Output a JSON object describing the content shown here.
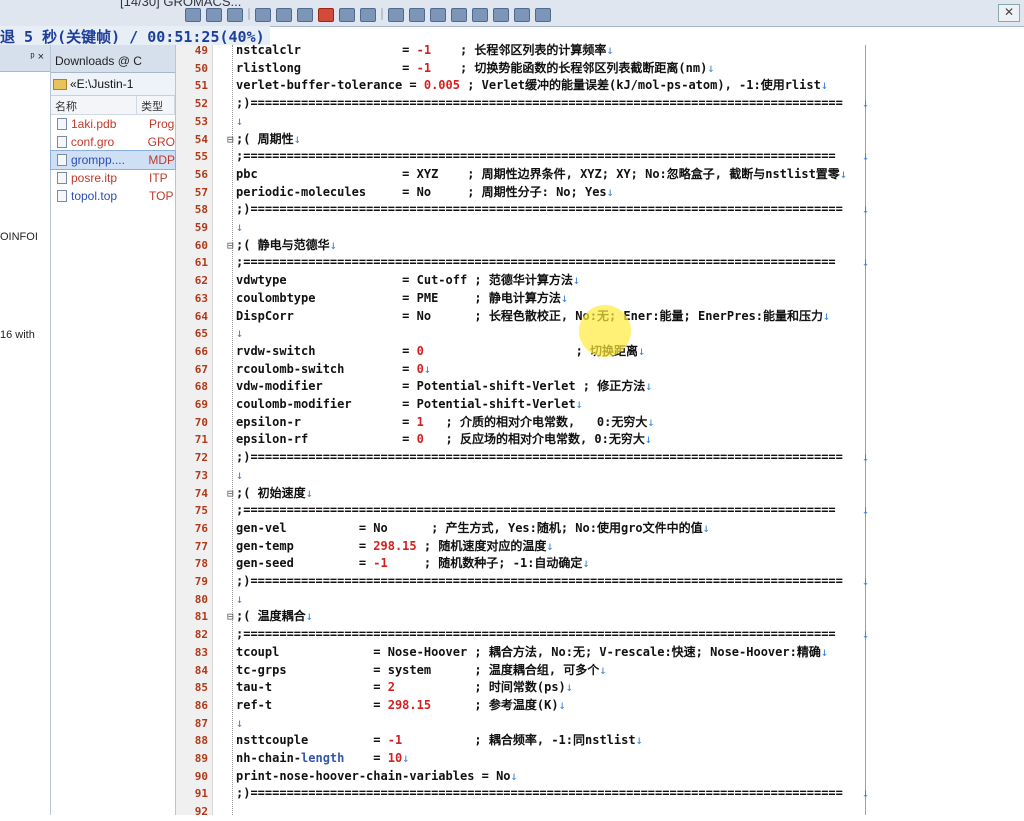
{
  "window": {
    "title": "[14/30] GROMACS...",
    "close_label": "✕"
  },
  "recording": {
    "text": "退 5 秒(关键帧) / 00:51:25(40%)"
  },
  "left_panel": {
    "pin": "ᵖ ×",
    "texts": [
      "OINFOI",
      "16 with"
    ]
  },
  "file_panel": {
    "tab_label": "Downloads @ C",
    "path_label": "«E:\\Justin-1",
    "columns": [
      "名称",
      "类型"
    ],
    "files": [
      {
        "name": "1aki.pdb",
        "type": "Prog",
        "color": "red"
      },
      {
        "name": "conf.gro",
        "type": "GRO",
        "color": "red"
      },
      {
        "name": "grompp....",
        "type": "MDP",
        "color": "blue",
        "selected": true
      },
      {
        "name": "posre.itp",
        "type": "ITP",
        "color": "red"
      },
      {
        "name": "topol.top",
        "type": "TOP",
        "color": "blue"
      }
    ]
  },
  "editor": {
    "lines": [
      {
        "n": "49",
        "fold": "",
        "segs": [
          {
            "t": "nstcalclr              = "
          },
          {
            "t": "-1",
            "c": "val"
          },
          {
            "t": "    ; 长程邻区列表的计算频率"
          }
        ],
        "eol": "↓"
      },
      {
        "n": "50",
        "fold": "",
        "segs": [
          {
            "t": "rlistlong              = "
          },
          {
            "t": "-1",
            "c": "val"
          },
          {
            "t": "    ; 切换势能函数的长程邻区列表截断距离(nm)"
          }
        ],
        "eol": "↓"
      },
      {
        "n": "51",
        "fold": "",
        "segs": [
          {
            "t": "verlet-buffer-tolerance = "
          },
          {
            "t": "0.005",
            "c": "val"
          },
          {
            "t": " ; Verlet缓冲的能量误差(kJ/mol-ps-atom), -1:使用rlist"
          }
        ],
        "eol": "↓"
      },
      {
        "n": "52",
        "fold": "",
        "segs": [
          {
            "t": ";)=================================================================================="
          }
        ],
        "eol": "",
        "eolm": "↓"
      },
      {
        "n": "53",
        "fold": "",
        "segs": [],
        "eol": "↓"
      },
      {
        "n": "54",
        "fold": "⊟",
        "segs": [
          {
            "t": ";( 周期性"
          }
        ],
        "eol": "↓"
      },
      {
        "n": "55",
        "fold": "",
        "segs": [
          {
            "t": ";=================================================================================="
          }
        ],
        "eol": "",
        "eolm": "↓"
      },
      {
        "n": "56",
        "fold": "",
        "segs": [
          {
            "t": "pbc                    = XYZ    ; 周期性边界条件, XYZ; XY; No:忽略盒子, 截断与nstlist置零"
          }
        ],
        "eol": "↓"
      },
      {
        "n": "57",
        "fold": "",
        "segs": [
          {
            "t": "periodic-molecules     = No     ; 周期性分子: No; Yes"
          }
        ],
        "eol": "↓"
      },
      {
        "n": "58",
        "fold": "",
        "segs": [
          {
            "t": ";)=================================================================================="
          }
        ],
        "eol": "",
        "eolm": "↓"
      },
      {
        "n": "59",
        "fold": "",
        "segs": [],
        "eol": "↓"
      },
      {
        "n": "60",
        "fold": "⊟",
        "segs": [
          {
            "t": ";( 静电与范德华"
          }
        ],
        "eol": "↓"
      },
      {
        "n": "61",
        "fold": "",
        "segs": [
          {
            "t": ";=================================================================================="
          }
        ],
        "eol": "",
        "eolm": "↓"
      },
      {
        "n": "62",
        "fold": "",
        "segs": [
          {
            "t": "vdwtype                = Cut-off ; 范德华计算方法"
          }
        ],
        "eol": "↓"
      },
      {
        "n": "63",
        "fold": "",
        "segs": [
          {
            "t": "coulombtype            = PME     ; 静电计算方法"
          }
        ],
        "eol": "↓"
      },
      {
        "n": "64",
        "fold": "",
        "segs": [
          {
            "t": "DispCorr               = No      ; 长程色散校正, No:无; Ener:能量; EnerPres:能量和压力"
          }
        ],
        "eol": "↓"
      },
      {
        "n": "65",
        "fold": "",
        "segs": [],
        "eol": "↓"
      },
      {
        "n": "66",
        "fold": "",
        "segs": [
          {
            "t": "rvdw-switch            = "
          },
          {
            "t": "0",
            "c": "val"
          },
          {
            "t": "                     ; 切换距离"
          }
        ],
        "eol": "↓"
      },
      {
        "n": "67",
        "fold": "",
        "segs": [
          {
            "t": "rcoulomb-switch        = "
          },
          {
            "t": "0",
            "c": "val"
          }
        ],
        "eol": "↓"
      },
      {
        "n": "68",
        "fold": "",
        "segs": [
          {
            "t": "vdw-modifier           = Potential-shift-Verlet ; 修正方法"
          }
        ],
        "eol": "↓"
      },
      {
        "n": "69",
        "fold": "",
        "segs": [
          {
            "t": "coulomb-modifier       = Potential-shift-Verlet"
          }
        ],
        "eol": "↓"
      },
      {
        "n": "70",
        "fold": "",
        "segs": [
          {
            "t": "epsilon-r              = "
          },
          {
            "t": "1",
            "c": "val"
          },
          {
            "t": "   ; 介质的相对介电常数,   0:无穷大"
          }
        ],
        "eol": "↓"
      },
      {
        "n": "71",
        "fold": "",
        "segs": [
          {
            "t": "epsilon-rf             = "
          },
          {
            "t": "0",
            "c": "val"
          },
          {
            "t": "   ; 反应场的相对介电常数, 0:无穷大"
          }
        ],
        "eol": "↓"
      },
      {
        "n": "72",
        "fold": "",
        "segs": [
          {
            "t": ";)=================================================================================="
          }
        ],
        "eol": "",
        "eolm": "↓"
      },
      {
        "n": "73",
        "fold": "",
        "segs": [],
        "eol": "↓"
      },
      {
        "n": "74",
        "fold": "⊟",
        "segs": [
          {
            "t": ";( 初始速度"
          }
        ],
        "eol": "↓"
      },
      {
        "n": "75",
        "fold": "",
        "segs": [
          {
            "t": ";=================================================================================="
          }
        ],
        "eol": "",
        "eolm": "↓"
      },
      {
        "n": "76",
        "fold": "",
        "segs": [
          {
            "t": "gen-vel          = No      ; 产生方式, Yes:随机; No:使用gro文件中的值"
          }
        ],
        "eol": "↓"
      },
      {
        "n": "77",
        "fold": "",
        "segs": [
          {
            "t": "gen-temp         = "
          },
          {
            "t": "298.15",
            "c": "val"
          },
          {
            "t": " ; 随机速度对应的温度"
          }
        ],
        "eol": "↓"
      },
      {
        "n": "78",
        "fold": "",
        "segs": [
          {
            "t": "gen-seed         = "
          },
          {
            "t": "-1",
            "c": "val"
          },
          {
            "t": "     ; 随机数种子; -1:自动确定"
          }
        ],
        "eol": "↓"
      },
      {
        "n": "79",
        "fold": "",
        "segs": [
          {
            "t": ";)=================================================================================="
          }
        ],
        "eol": "",
        "eolm": "↓"
      },
      {
        "n": "80",
        "fold": "",
        "segs": [],
        "eol": "↓"
      },
      {
        "n": "81",
        "fold": "⊟",
        "segs": [
          {
            "t": ";( 温度耦合"
          }
        ],
        "eol": "↓"
      },
      {
        "n": "82",
        "fold": "",
        "segs": [
          {
            "t": ";=================================================================================="
          }
        ],
        "eol": "",
        "eolm": "↓"
      },
      {
        "n": "83",
        "fold": "",
        "segs": [
          {
            "t": "tcoupl             = Nose-Hoover ; 耦合方法, No:无; V-rescale:快速; Nose-Hoover:精确"
          }
        ],
        "eol": "↓"
      },
      {
        "n": "84",
        "fold": "",
        "segs": [
          {
            "t": "tc-grps            = system      ; 温度耦合组, 可多个"
          }
        ],
        "eol": "↓"
      },
      {
        "n": "85",
        "fold": "",
        "segs": [
          {
            "t": "tau-t              = "
          },
          {
            "t": "2",
            "c": "val"
          },
          {
            "t": "           ; 时间常数(ps)"
          }
        ],
        "eol": "↓"
      },
      {
        "n": "86",
        "fold": "",
        "segs": [
          {
            "t": "ref-t              = "
          },
          {
            "t": "298.15",
            "c": "val"
          },
          {
            "t": "      ; 参考温度(K)"
          }
        ],
        "eol": "↓"
      },
      {
        "n": "87",
        "fold": "",
        "segs": [],
        "eol": "↓"
      },
      {
        "n": "88",
        "fold": "",
        "segs": [
          {
            "t": "nsttcouple         = "
          },
          {
            "t": "-1",
            "c": "val"
          },
          {
            "t": "          ; 耦合频率, -1:同nstlist"
          }
        ],
        "eol": "↓"
      },
      {
        "n": "89",
        "fold": "",
        "segs": [
          {
            "t": "nh-chain-"
          },
          {
            "t": "length",
            "c": "hi"
          },
          {
            "t": "    = "
          },
          {
            "t": "10",
            "c": "val"
          }
        ],
        "eol": "↓"
      },
      {
        "n": "90",
        "fold": "",
        "segs": [
          {
            "t": "print-nose-hoover-chain-variables = No"
          }
        ],
        "eol": "↓"
      },
      {
        "n": "91",
        "fold": "",
        "segs": [
          {
            "t": ";)=================================================================================="
          }
        ],
        "eol": "",
        "eolm": "↓"
      },
      {
        "n": "92",
        "fold": "",
        "segs": [],
        "eol": ""
      }
    ]
  }
}
